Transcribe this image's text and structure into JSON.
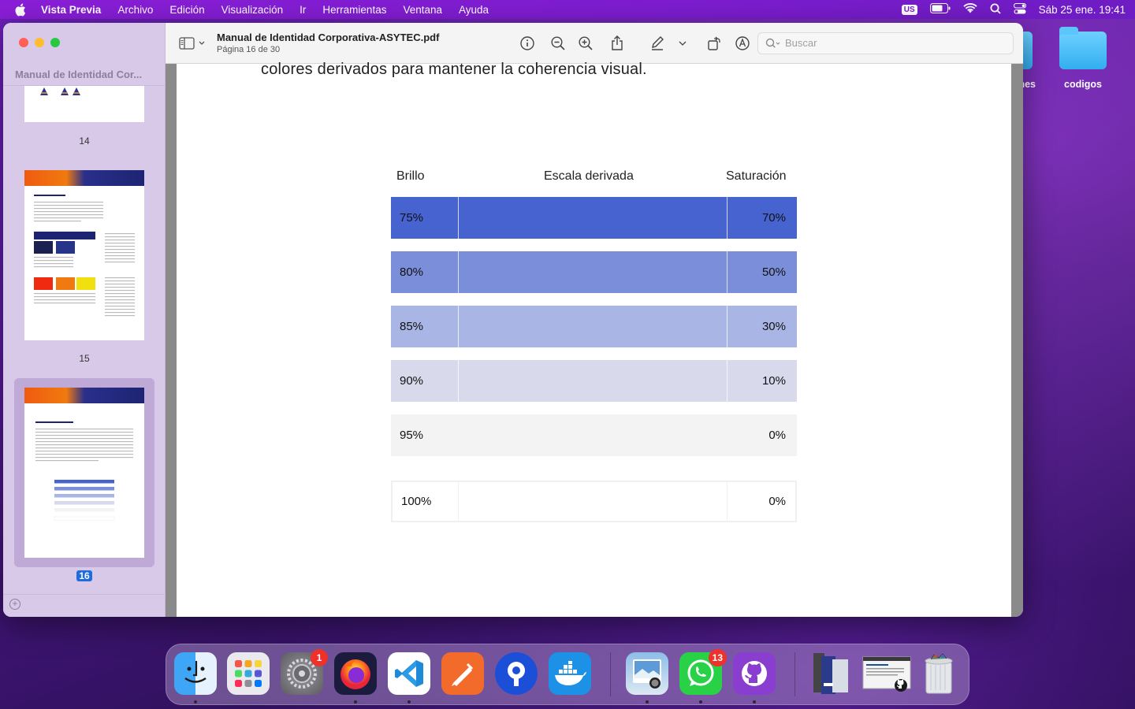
{
  "menubar": {
    "app_name": "Vista Previa",
    "items": [
      "Archivo",
      "Edición",
      "Visualización",
      "Ir",
      "Herramientas",
      "Ventana",
      "Ayuda"
    ],
    "input_source": "US",
    "clock": "Sáb 25 ene.  19:41"
  },
  "desktop": {
    "folders": [
      {
        "label": "nes"
      },
      {
        "label": "codigos"
      }
    ]
  },
  "sidebar": {
    "title": "Manual de Identidad Cor...",
    "pages": [
      {
        "number": "14",
        "selected": false
      },
      {
        "number": "15",
        "selected": false
      },
      {
        "number": "16",
        "selected": true
      }
    ]
  },
  "toolbar": {
    "doc_title": "Manual de Identidad Corporativa-ASYTEC.pdf",
    "page_info": "Página 16 de 30",
    "search_placeholder": "Buscar"
  },
  "document": {
    "intro_line": "colores derivados para mantener la coherencia visual.",
    "table": {
      "headers": {
        "brightness": "Brillo",
        "scale": "Escala derivada",
        "saturation": "Saturación"
      },
      "rows": [
        {
          "brightness": "75%",
          "saturation": "70%",
          "color": "#4763cf"
        },
        {
          "brightness": "80%",
          "saturation": "50%",
          "color": "#7a8ed9"
        },
        {
          "brightness": "85%",
          "saturation": "30%",
          "color": "#a9b5e5"
        },
        {
          "brightness": "90%",
          "saturation": "10%",
          "color": "#d8daec"
        },
        {
          "brightness": "95%",
          "saturation": "0%",
          "color": "#f3f3f3"
        },
        {
          "brightness": "100%",
          "saturation": "0%",
          "color": "#ffffff"
        }
      ]
    }
  },
  "dock": {
    "apps": [
      {
        "name": "finder-icon",
        "badge": ""
      },
      {
        "name": "launchpad-icon",
        "badge": ""
      },
      {
        "name": "system-settings-icon",
        "badge": "1"
      },
      {
        "name": "firefox-icon",
        "badge": ""
      },
      {
        "name": "vscode-icon",
        "badge": ""
      },
      {
        "name": "postman-icon",
        "badge": ""
      },
      {
        "name": "proton-pass-icon",
        "badge": ""
      },
      {
        "name": "docker-icon",
        "badge": ""
      },
      {
        "name": "preview-icon",
        "badge": ""
      },
      {
        "name": "whatsapp-icon",
        "badge": "13"
      },
      {
        "name": "github-desktop-icon",
        "badge": ""
      }
    ]
  }
}
